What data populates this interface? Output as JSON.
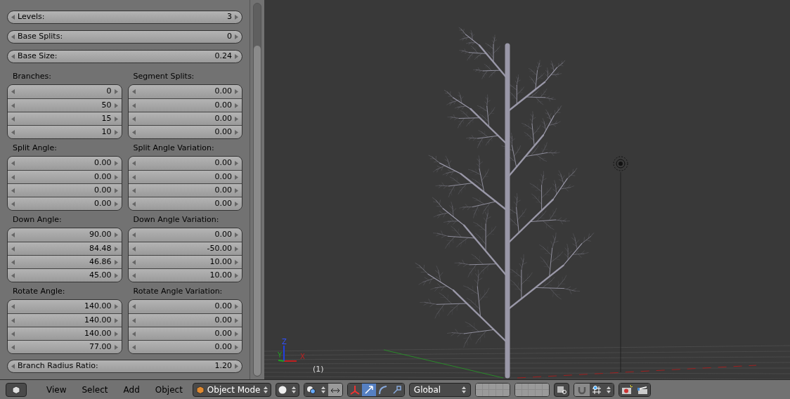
{
  "panel": {
    "top_fields": [
      {
        "label": "Levels:",
        "value": "3"
      },
      {
        "label": "Base Splits:",
        "value": "0"
      },
      {
        "label": "Base Size:",
        "value": "0.24"
      }
    ],
    "groups": [
      {
        "left": {
          "label": "Branches:",
          "values": [
            "0",
            "50",
            "15",
            "10"
          ]
        },
        "right": {
          "label": "Segment Splits:",
          "values": [
            "0.00",
            "0.00",
            "0.00",
            "0.00"
          ]
        }
      },
      {
        "left": {
          "label": "Split Angle:",
          "values": [
            "0.00",
            "0.00",
            "0.00",
            "0.00"
          ]
        },
        "right": {
          "label": "Split Angle Variation:",
          "values": [
            "0.00",
            "0.00",
            "0.00",
            "0.00"
          ]
        }
      },
      {
        "left": {
          "label": "Down Angle:",
          "values": [
            "90.00",
            "84.48",
            "46.86",
            "45.00"
          ]
        },
        "right": {
          "label": "Down Angle Variation:",
          "values": [
            "0.00",
            "-50.00",
            "10.00",
            "10.00"
          ]
        }
      },
      {
        "left": {
          "label": "Rotate Angle:",
          "values": [
            "140.00",
            "140.00",
            "140.00",
            "77.00"
          ]
        },
        "right": {
          "label": "Rotate Angle Variation:",
          "values": [
            "0.00",
            "0.00",
            "0.00",
            "0.00"
          ]
        }
      }
    ],
    "bottom_field": {
      "label": "Branch Radius Ratio:",
      "value": "1.20"
    }
  },
  "viewport": {
    "frame_label": "(1)",
    "axes": [
      "X",
      "Y",
      "Z"
    ]
  },
  "toolbar": {
    "menus": [
      "View",
      "Select",
      "Add",
      "Object"
    ],
    "mode": "Object Mode",
    "orientation": "Global",
    "manipulators": [
      {
        "kind": "axes",
        "selected": false
      },
      {
        "kind": "translate",
        "selected": true
      },
      {
        "kind": "rotate",
        "selected": false
      },
      {
        "kind": "scale",
        "selected": false
      }
    ]
  }
}
